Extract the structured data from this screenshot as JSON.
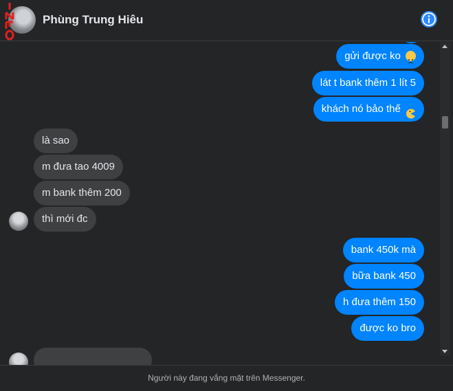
{
  "header": {
    "contact_name": "Phùng Trung Hiêu",
    "watermark": "INFO",
    "info_icon": "info-icon"
  },
  "messages": {
    "out1": "gửi được ko",
    "out2": "lát t bank thêm 1 lít 5",
    "out3": "khách nó bảo thế",
    "in1": "là sao",
    "in2": "m đưa tao 4009",
    "in3": "m bank thêm 200",
    "in4": "thì mới đc",
    "out4": "bank 450k mà",
    "out5": "bữa bank 450",
    "out6": "h đưa thêm 150",
    "out7": "được ko bro"
  },
  "footer": {
    "status_text": "Người này đang vắng mặt trên Messenger."
  },
  "colors": {
    "background": "#242526",
    "outgoing_bubble": "#0084ff",
    "incoming_bubble": "#3e4042",
    "accent": "#2e89ff"
  }
}
